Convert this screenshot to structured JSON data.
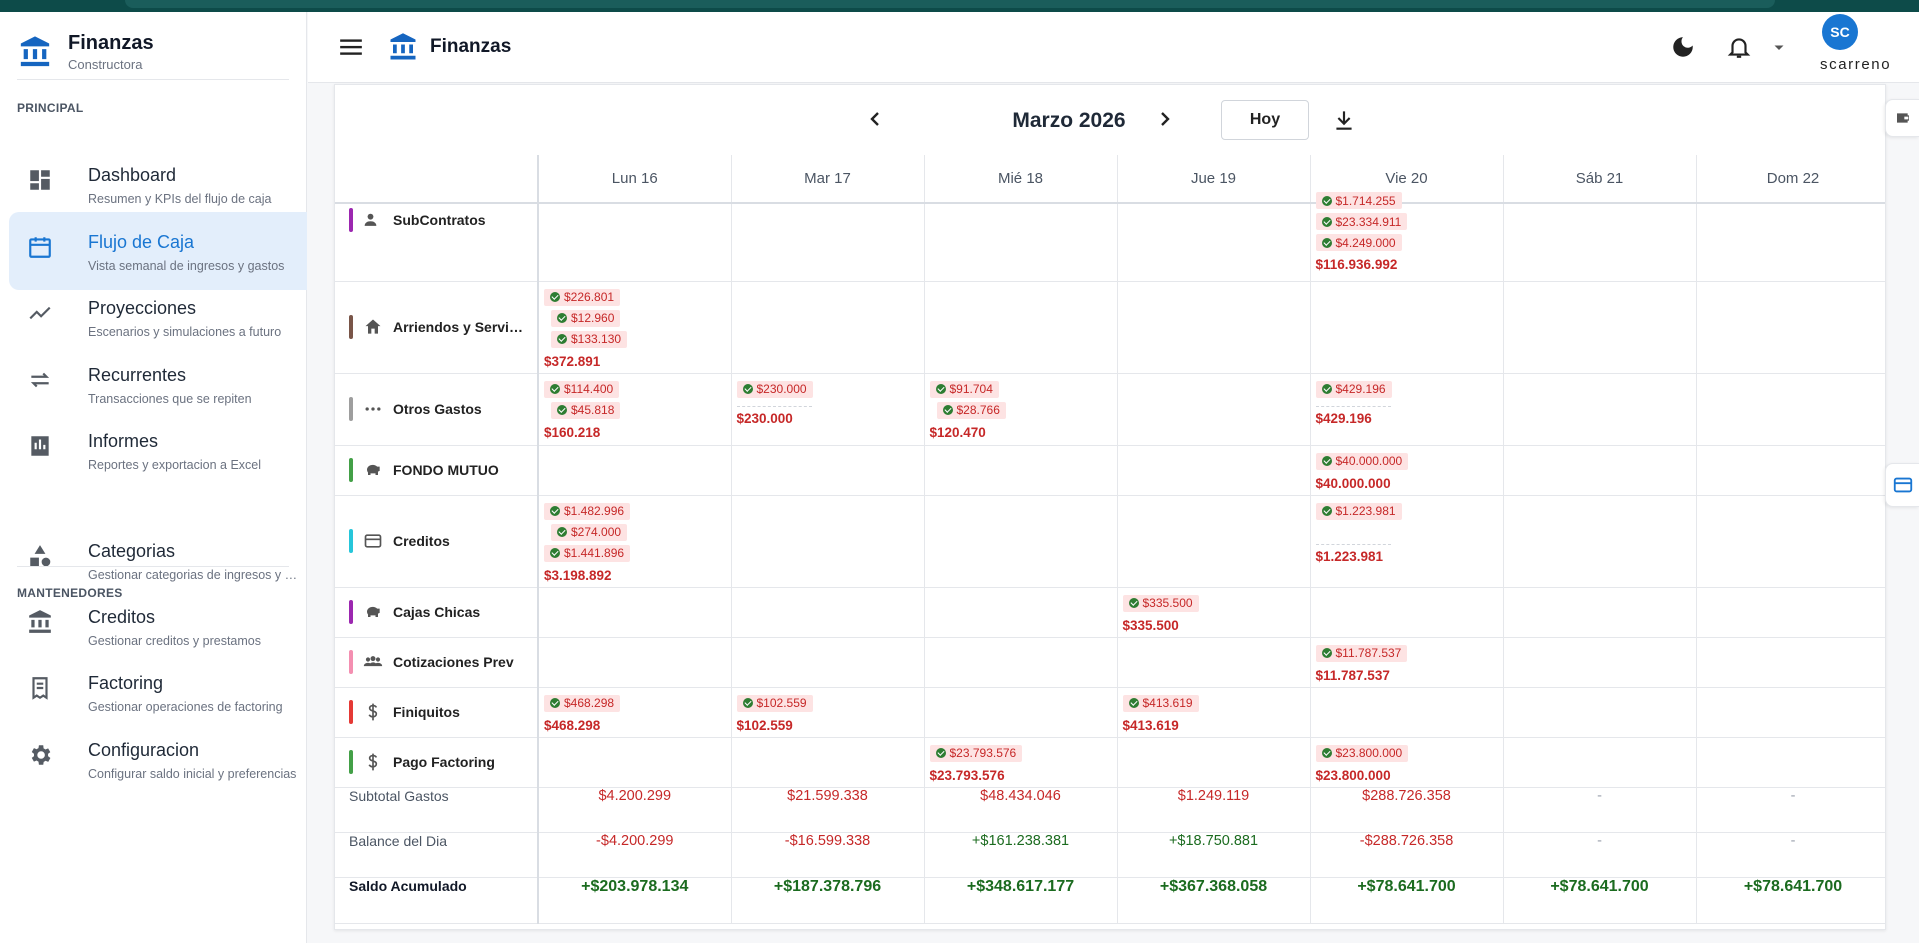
{
  "app": {
    "brand_title": "Finanzas",
    "brand_subtitle": "Constructora"
  },
  "sidebar": {
    "section_principal": "PRINCIPAL",
    "section_mantenedores": "MANTENEDORES",
    "items": [
      {
        "title": "Dashboard",
        "subtitle": "Resumen y KPIs del flujo de caja",
        "icon": "dashboard-icon"
      },
      {
        "title": "Flujo de Caja",
        "subtitle": "Vista semanal de ingresos y gastos",
        "icon": "calendar-icon",
        "active": true
      },
      {
        "title": "Proyecciones",
        "subtitle": "Escenarios y simulaciones a futuro",
        "icon": "trending-icon"
      },
      {
        "title": "Recurrentes",
        "subtitle": "Transacciones que se repiten",
        "icon": "repeat-icon"
      },
      {
        "title": "Informes",
        "subtitle": "Reportes y exportacion a Excel",
        "icon": "report-icon"
      },
      {
        "title": "Categorias",
        "subtitle": "Gestionar categorias de ingresos y gastos",
        "icon": "category-icon"
      },
      {
        "title": "Creditos",
        "subtitle": "Gestionar creditos y prestamos",
        "icon": "bank-icon"
      },
      {
        "title": "Factoring",
        "subtitle": "Gestionar operaciones de factoring",
        "icon": "receipt-icon"
      },
      {
        "title": "Configuracion",
        "subtitle": "Configurar saldo inicial y preferencias",
        "icon": "gear-icon"
      }
    ]
  },
  "header": {
    "title": "Finanzas",
    "avatar_initials": "SC",
    "username": "scarreno"
  },
  "calendar": {
    "month": "Marzo 2026",
    "today_label": "Hoy",
    "days": [
      "Lun 16",
      "Mar 17",
      "Mié 18",
      "Jue 19",
      "Vie 20",
      "Sáb 21",
      "Dom 22"
    ]
  },
  "colors": {
    "primary": "#1976d2",
    "expense": "#c62828",
    "income": "#1b6b1f",
    "chip_bg": "#fde3e3"
  },
  "rows": [
    {
      "name": "SubContratos",
      "icon": "people-icon",
      "color": "#9c27b0",
      "cells": [
        null,
        null,
        null,
        null,
        {
          "chips": [
            "$1.714.255",
            "$23.334.911",
            "$4.249.000"
          ],
          "total": "$116.936.992"
        },
        null,
        null
      ]
    },
    {
      "name": "Arriendos y Servicios",
      "icon": "home-icon",
      "color": "#795548",
      "cells": [
        {
          "chips": [
            "$226.801",
            "$12.960",
            "$133.130"
          ],
          "total": "$372.891"
        },
        null,
        null,
        null,
        null,
        null,
        null
      ]
    },
    {
      "name": "Otros Gastos",
      "icon": "more-icon",
      "color": "#9e9e9e",
      "cells": [
        {
          "chips": [
            "$114.400",
            "$45.818"
          ],
          "total": "$160.218"
        },
        {
          "chips": [
            "$230.000"
          ],
          "total": "$230.000",
          "dashed": true
        },
        {
          "chips": [
            "$91.704",
            "$28.766"
          ],
          "total": "$120.470"
        },
        null,
        {
          "chips": [
            "$429.196"
          ],
          "total": "$429.196",
          "dashed": true
        },
        null,
        null
      ]
    },
    {
      "name": "FONDO MUTUO",
      "icon": "piggy-icon",
      "color": "#43a047",
      "cells": [
        null,
        null,
        null,
        null,
        {
          "chips": [
            "$40.000.000"
          ],
          "total": "$40.000.000"
        },
        null,
        null
      ]
    },
    {
      "name": "Creditos",
      "icon": "card-icon",
      "color": "#26c6da",
      "cells": [
        {
          "chips": [
            "$1.482.996",
            "$274.000",
            "$1.441.896"
          ],
          "total": "$3.198.892"
        },
        null,
        null,
        null,
        {
          "chips": [
            "$1.223.981"
          ],
          "total": "$1.223.981",
          "dashed": true,
          "tall": true
        },
        null,
        null
      ]
    },
    {
      "name": "Cajas Chicas",
      "icon": "piggy-icon",
      "color": "#9c27b0",
      "cells": [
        null,
        null,
        null,
        {
          "chips": [
            "$335.500"
          ],
          "total": "$335.500"
        },
        null,
        null,
        null
      ]
    },
    {
      "name": "Cotizaciones Prev",
      "icon": "group-icon",
      "color": "#f48fb1",
      "cells": [
        null,
        null,
        null,
        null,
        {
          "chips": [
            "$11.787.537"
          ],
          "total": "$11.787.537"
        },
        null,
        null
      ]
    },
    {
      "name": "Finiquitos",
      "icon": "dollar-icon",
      "color": "#e53935",
      "cells": [
        {
          "chips": [
            "$468.298"
          ],
          "total": "$468.298"
        },
        {
          "chips": [
            "$102.559"
          ],
          "total": "$102.559"
        },
        null,
        {
          "chips": [
            "$413.619"
          ],
          "total": "$413.619"
        },
        null,
        null,
        null
      ]
    },
    {
      "name": "Pago Factoring",
      "icon": "dollar-icon",
      "color": "#43a047",
      "cells": [
        null,
        null,
        {
          "chips": [
            "$23.793.576"
          ],
          "total": "$23.793.576"
        },
        null,
        {
          "chips": [
            "$23.800.000"
          ],
          "total": "$23.800.000"
        },
        null,
        null
      ]
    }
  ],
  "summary": {
    "subtotal_label": "Subtotal Gastos",
    "subtotal": [
      "$4.200.299",
      "$21.599.338",
      "$48.434.046",
      "$1.249.119",
      "$288.726.358",
      "-",
      "-"
    ],
    "balance_label": "Balance del Dia",
    "balance": [
      "-$4.200.299",
      "-$16.599.338",
      "+$161.238.381",
      "+$18.750.881",
      "-$288.726.358",
      "-",
      "-"
    ],
    "saldo_label": "Saldo Acumulado",
    "saldo": [
      "+$203.978.134",
      "+$187.378.796",
      "+$348.617.177",
      "+$367.368.058",
      "+$78.641.700",
      "+$78.641.700",
      "+$78.641.700"
    ]
  }
}
